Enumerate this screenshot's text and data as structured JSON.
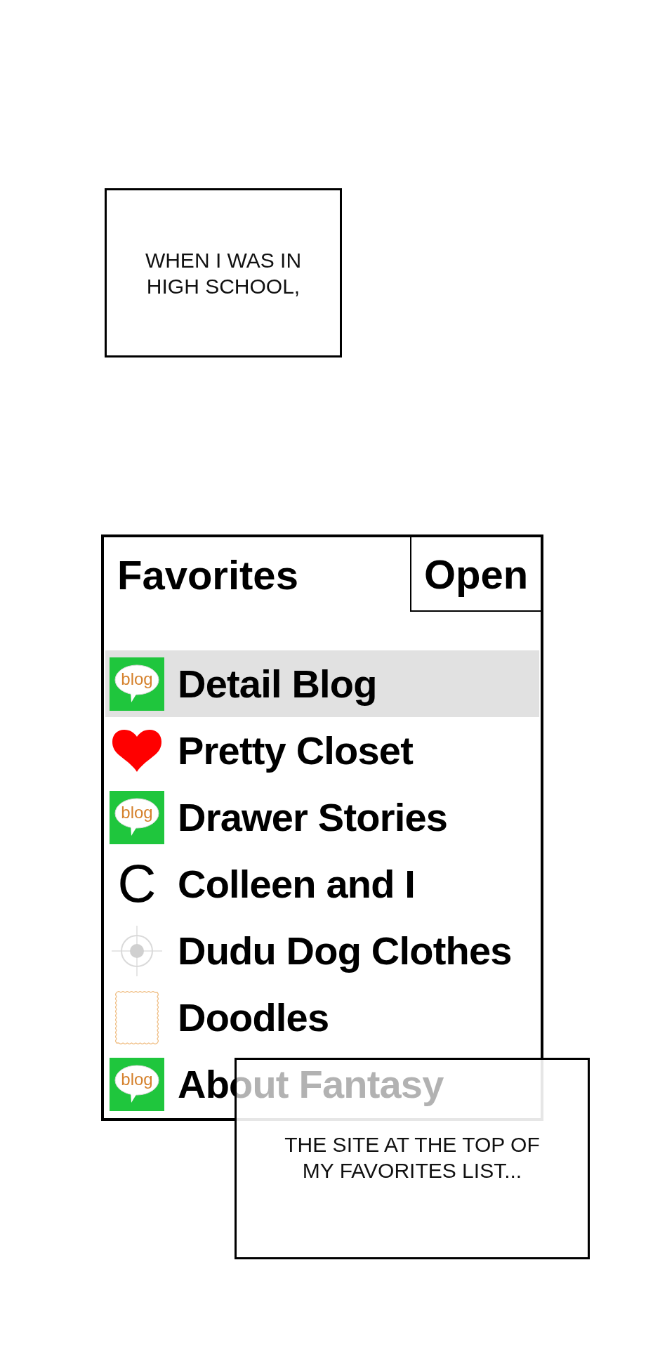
{
  "caption_top": {
    "text": "WHEN I WAS IN\nHIGH SCHOOL,"
  },
  "favorites": {
    "title": "Favorites",
    "open_button": "Open",
    "items": [
      {
        "kind": "blog",
        "logo_text": "blog",
        "label": "Detail Blog",
        "selected": true
      },
      {
        "kind": "heart",
        "label": "Pretty Closet",
        "selected": false
      },
      {
        "kind": "blog",
        "logo_text": "blog",
        "label": "Drawer Stories",
        "selected": false
      },
      {
        "kind": "letter",
        "logo_text": "C",
        "label": "Colleen and I",
        "selected": false
      },
      {
        "kind": "crosshair",
        "label": "Dudu Dog Clothes",
        "selected": false
      },
      {
        "kind": "stamp",
        "label": "Doodles",
        "selected": false
      },
      {
        "kind": "blog",
        "logo_text": "blog",
        "label": "About Fantasy",
        "selected": false
      }
    ]
  },
  "caption_bottom": {
    "text": "THE SITE AT THE TOP OF\nMY FAVORITES LIST..."
  }
}
